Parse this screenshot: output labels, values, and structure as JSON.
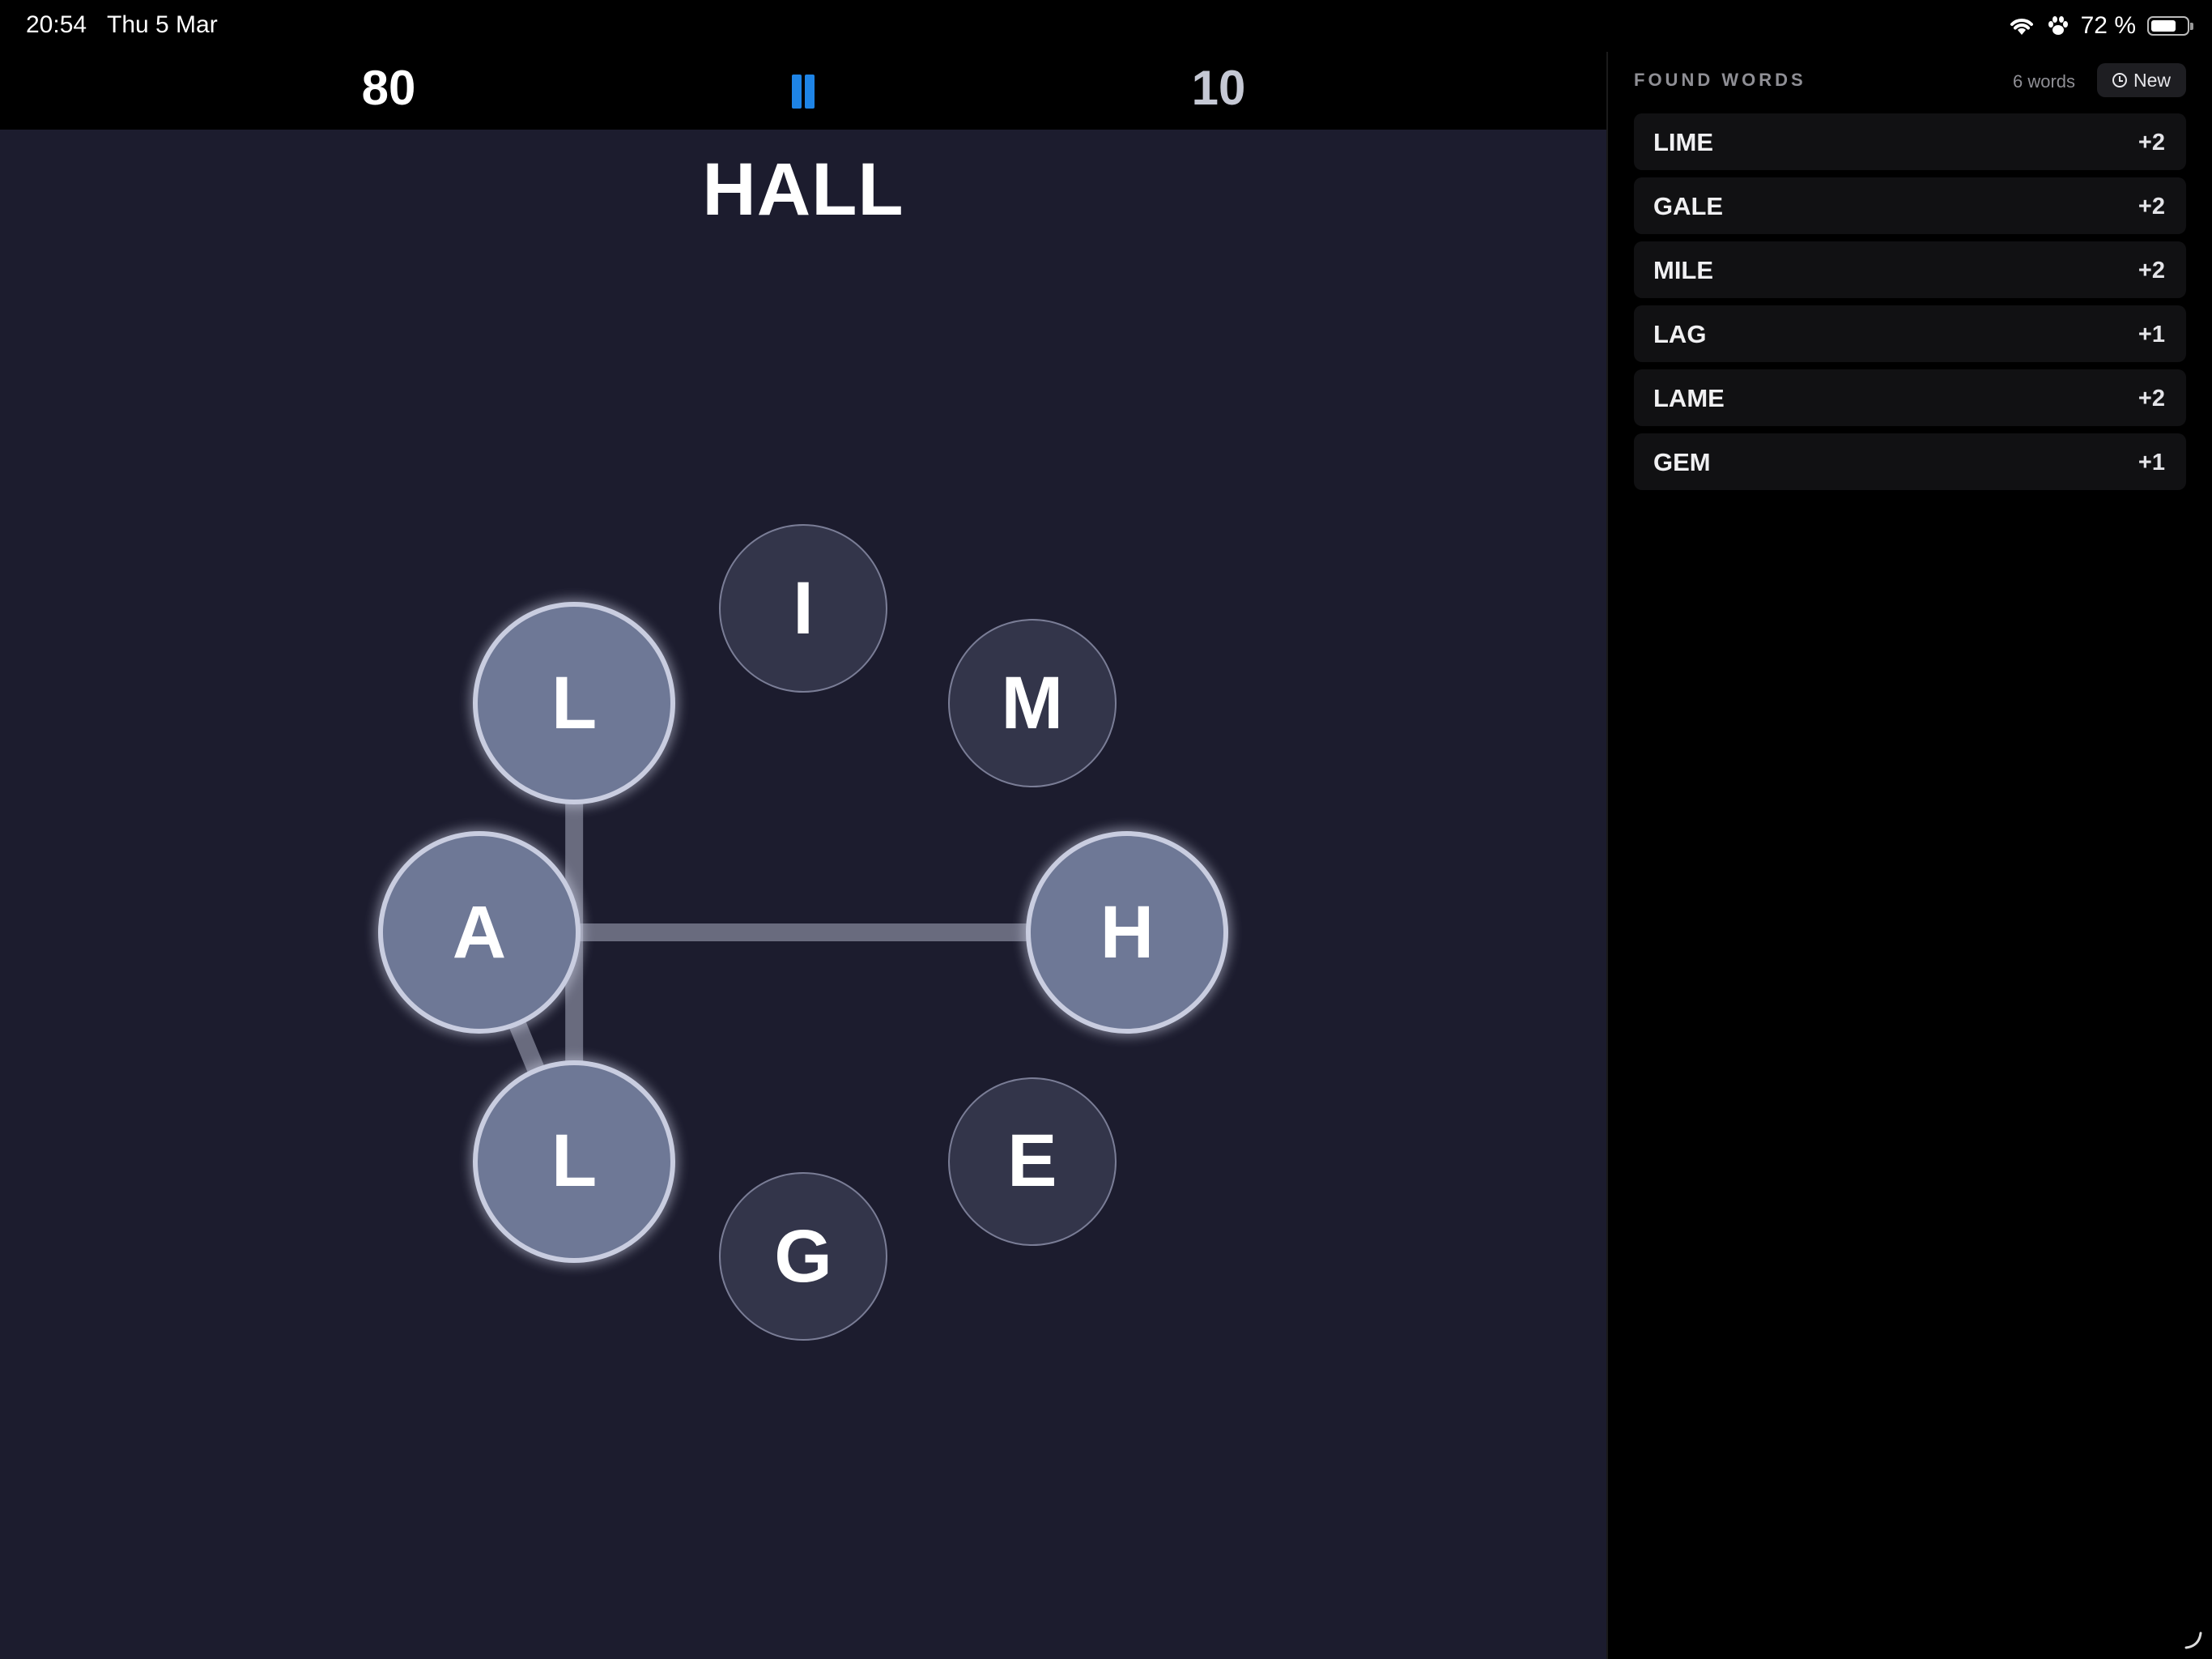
{
  "status_bar": {
    "time": "20:54",
    "date": "Thu 5 Mar",
    "battery_text": "72 %",
    "battery_level": 0.72,
    "icons": [
      "wifi-icon",
      "paw-icon",
      "battery-icon"
    ]
  },
  "game": {
    "score": "80",
    "timer": "10",
    "current_word": "HALL",
    "accent_color": "#1e84e6",
    "tiles": [
      {
        "letter": "I",
        "selected": false
      },
      {
        "letter": "M",
        "selected": false
      },
      {
        "letter": "H",
        "selected": true
      },
      {
        "letter": "E",
        "selected": false
      },
      {
        "letter": "G",
        "selected": false
      },
      {
        "letter": "L",
        "selected": true
      },
      {
        "letter": "A",
        "selected": true
      },
      {
        "letter": "L",
        "selected": true
      }
    ],
    "path": [
      "H",
      "A",
      "L",
      "L"
    ]
  },
  "sidebar": {
    "header": "FOUND WORDS",
    "count": "6 words",
    "new_label": "New",
    "words": [
      {
        "word": "LIME",
        "points": "+2"
      },
      {
        "word": "GALE",
        "points": "+2"
      },
      {
        "word": "MILE",
        "points": "+2"
      },
      {
        "word": "LAG",
        "points": "+1"
      },
      {
        "word": "LAME",
        "points": "+2"
      },
      {
        "word": "GEM",
        "points": "+1"
      }
    ]
  }
}
